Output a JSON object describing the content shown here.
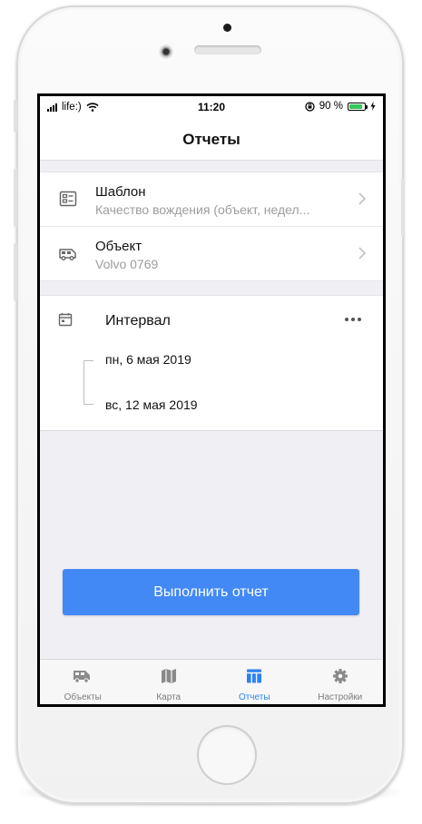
{
  "status_bar": {
    "carrier": "life:)",
    "time": "11:20",
    "battery_percent": "90 %",
    "battery_level": 0.9
  },
  "header": {
    "title": "Отчеты"
  },
  "template_row": {
    "label": "Шаблон",
    "value": "Качество вождения (объект, недел...",
    "icon": "template-icon"
  },
  "object_row": {
    "label": "Объект",
    "value": "Volvo 0769",
    "icon": "truck-icon"
  },
  "interval": {
    "label": "Интервал",
    "from": "пн, 6 мая 2019",
    "to": "вс, 12 мая 2019",
    "icon": "calendar-icon"
  },
  "run_button": {
    "label": "Выполнить отчет",
    "color": "#4389f5"
  },
  "tabs": [
    {
      "label": "Объекты",
      "icon": "truck-icon",
      "active": false
    },
    {
      "label": "Карта",
      "icon": "map-icon",
      "active": false
    },
    {
      "label": "Отчеты",
      "icon": "reports-icon",
      "active": true
    },
    {
      "label": "Настройки",
      "icon": "settings-icon",
      "active": false
    }
  ],
  "colors": {
    "accent": "#2d82f0",
    "battery": "#34c759"
  }
}
